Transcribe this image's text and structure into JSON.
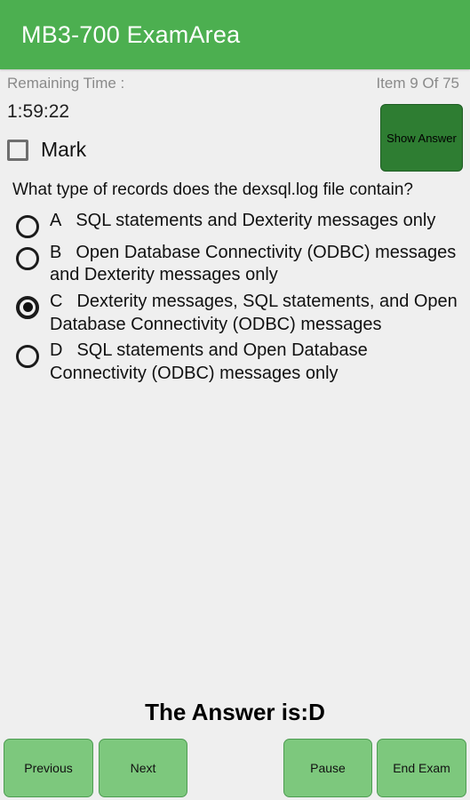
{
  "appbar": {
    "title": "MB3-700 ExamArea"
  },
  "status": {
    "remaining_time_label": "Remaining Time :",
    "item_counter": "Item 9 Of 75"
  },
  "timer": {
    "value": "1:59:22"
  },
  "mark": {
    "label": "Mark",
    "checked": false
  },
  "show_answer": {
    "label": "Show Answer"
  },
  "question": {
    "text": "What type of records does the dexsql.log file contain?"
  },
  "options": [
    {
      "letter": "A",
      "text": "SQL statements and Dexterity messages only",
      "selected": false
    },
    {
      "letter": "B",
      "text": "Open Database Connectivity (ODBC) messages and Dexterity messages only",
      "selected": false
    },
    {
      "letter": "C",
      "text": "Dexterity messages, SQL statements, and Open Database Connectivity (ODBC) messages",
      "selected": true
    },
    {
      "letter": "D",
      "text": "SQL statements and Open Database Connectivity (ODBC) messages only",
      "selected": false
    }
  ],
  "answer_reveal": {
    "text": "The Answer is:D"
  },
  "bottom_buttons": {
    "previous": "Previous",
    "next": "Next",
    "pause": "Pause",
    "end_exam": "End Exam"
  },
  "colors": {
    "appbar_green": "#4CAF50",
    "show_answer_green": "#2E7D32",
    "nav_button_green": "#7DC87D",
    "background": "#EFEFEF",
    "muted_text": "#8A8A8A"
  }
}
